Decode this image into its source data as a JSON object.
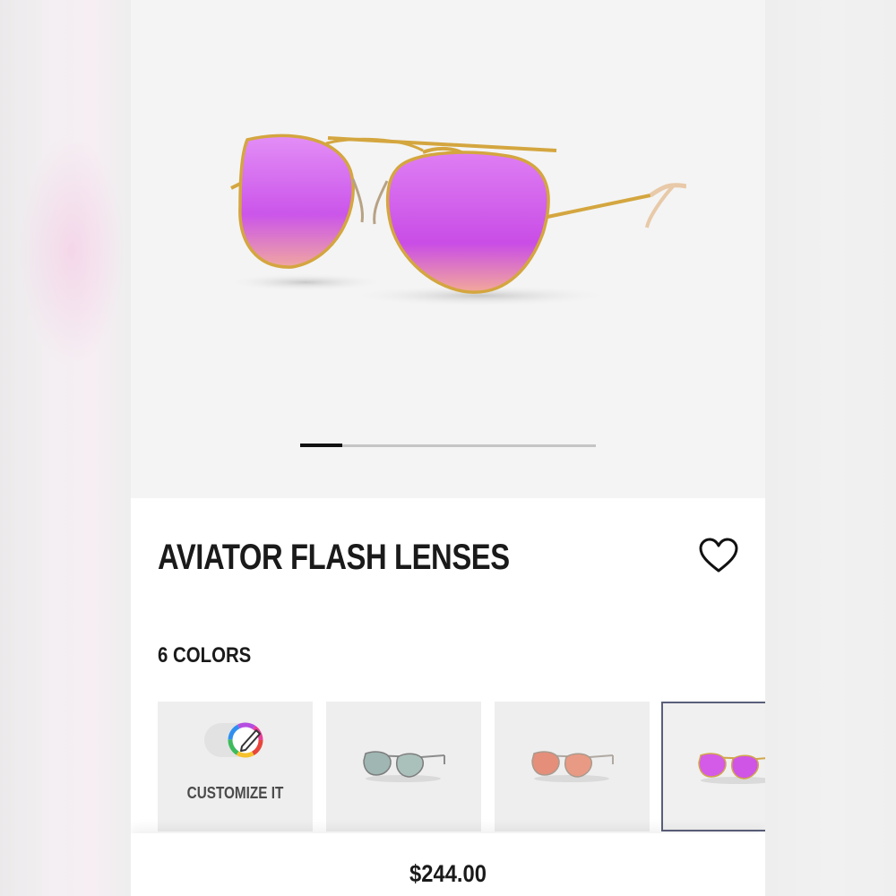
{
  "product": {
    "name": "AVIATOR FLASH LENSES",
    "price": "$244.00",
    "favorite_icon": "heart-icon"
  },
  "gallery": {
    "image_count": 7,
    "current_index": 1
  },
  "colors": {
    "count_label": "6 COLORS",
    "customize_label": "CUSTOMIZE IT",
    "options": [
      {
        "name": "customize",
        "icon": "color-wheel-pencil-icon"
      },
      {
        "name": "silver-flash",
        "lens_color": "#9fb6b2",
        "frame_color": "#8c8c8c"
      },
      {
        "name": "copper-flash",
        "lens_color": "#e58e7a",
        "frame_color": "#b0a9a2"
      },
      {
        "name": "cyclamen-flash",
        "lens_color": "#d45ae8",
        "frame_color": "#d1a64a",
        "selected": true
      }
    ]
  },
  "theme": {
    "accent": "#111111",
    "lens": "#cf5bea",
    "frame": "#d4a63f",
    "selected_border": "#5a5f7a"
  }
}
